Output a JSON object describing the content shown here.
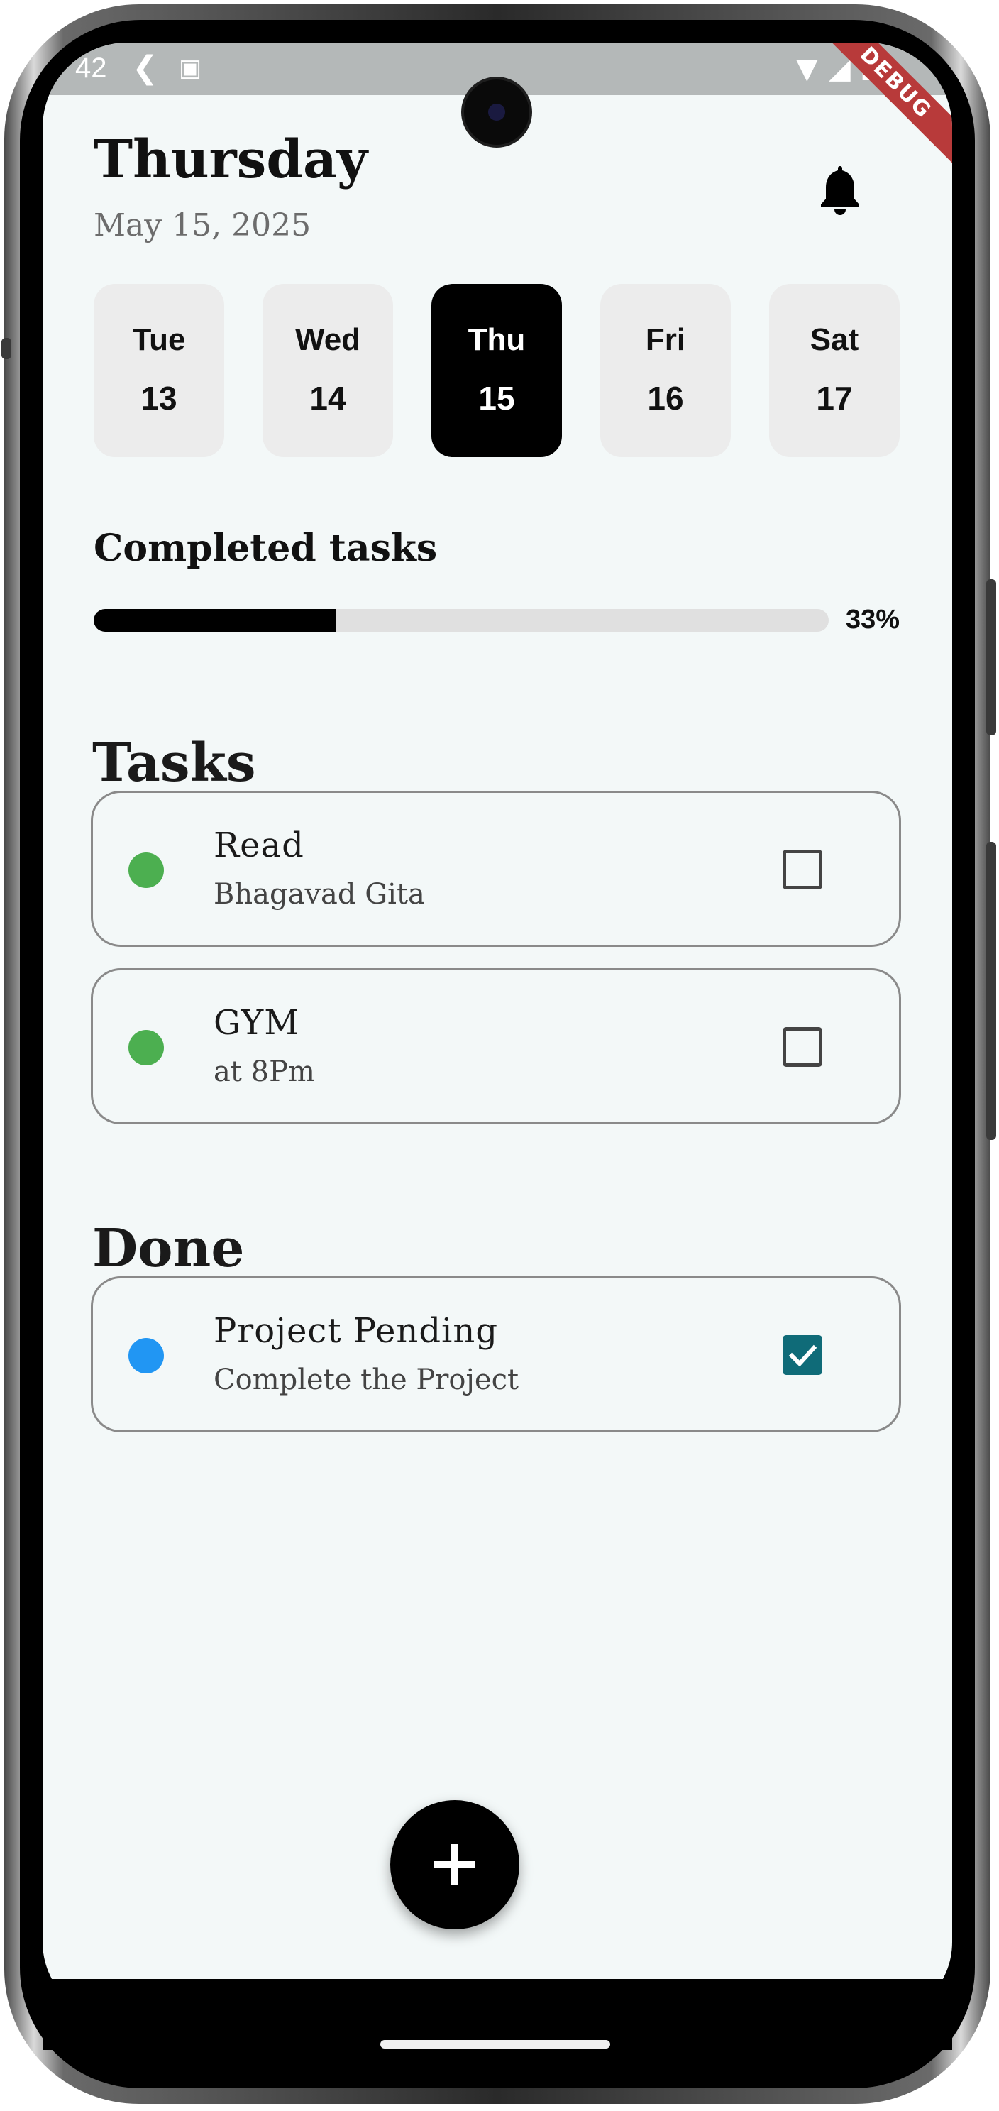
{
  "status_bar": {
    "time": "42",
    "debug_label": "DEBUG"
  },
  "header": {
    "title": "Thursday",
    "date": "May 15, 2025"
  },
  "days": [
    {
      "name": "Tue",
      "num": "13",
      "selected": false
    },
    {
      "name": "Wed",
      "num": "14",
      "selected": false
    },
    {
      "name": "Thu",
      "num": "15",
      "selected": true
    },
    {
      "name": "Fri",
      "num": "16",
      "selected": false
    },
    {
      "name": "Sat",
      "num": "17",
      "selected": false
    }
  ],
  "progress": {
    "label": "Completed tasks",
    "percent_text": "33%",
    "value": 0.33
  },
  "tasks": {
    "heading": "Tasks",
    "items": [
      {
        "title": "Read",
        "subtitle": "Bhagavad Gita",
        "dot_color": "#4caf50",
        "checked": false
      },
      {
        "title": "GYM",
        "subtitle": "at 8Pm",
        "dot_color": "#4caf50",
        "checked": false
      }
    ]
  },
  "done": {
    "heading": "Done",
    "items": [
      {
        "title": "Project Pending",
        "subtitle": "Complete the Project",
        "dot_color": "#2196f3",
        "checked": true
      }
    ]
  },
  "colors": {
    "background": "#f3f8f8",
    "accent_check": "#0f6b78",
    "selected_day": "#000000"
  }
}
